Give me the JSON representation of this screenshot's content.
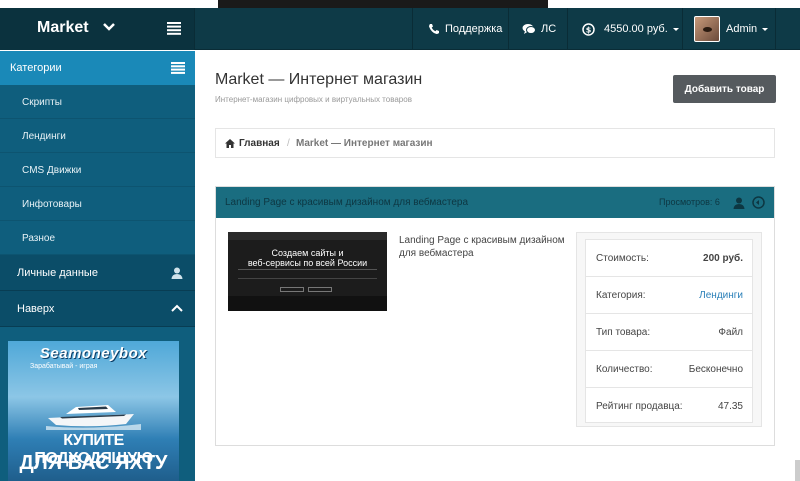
{
  "navbar": {
    "brand": "Market",
    "support_label": "Поддержка",
    "messages_label": "ЛС",
    "balance_label": "4550.00 руб.",
    "user_label": "Admin"
  },
  "sidebar": {
    "categories_header": "Категории",
    "items": [
      {
        "label": "Скрипты"
      },
      {
        "label": "Лендинги"
      },
      {
        "label": "CMS Движки"
      },
      {
        "label": "Инфотовары"
      },
      {
        "label": "Разное"
      }
    ],
    "personal_label": "Личные данные",
    "top_label": "Наверх",
    "banner": {
      "title": "Seamoneybox",
      "subtitle": "Зарабатывай - играя",
      "line1": "КУПИТЕ ПОДХОДЯЩУЮ",
      "line2": "ДЛЯ ВАС ЯХТУ"
    }
  },
  "main": {
    "title": "Market — Интернет магазин",
    "subtitle": "Интернет-магазин цифровых и виртуальных товаров",
    "add_button": "Добавить товар",
    "breadcrumb": {
      "home": "Главная",
      "separator": "/",
      "current": "Market — Интернет магазин"
    },
    "product": {
      "header_title": "Landing Page с красивым дизайном для вебмастера",
      "header_right": "Просмотров: 6",
      "thumb_heading_1": "Создаем сайты и",
      "thumb_heading_2": "веб-сервисы по всей России",
      "description": "Landing Page с красивым дизайном для вебмастера",
      "info": [
        {
          "key": "Стоимость:",
          "value": "200 руб."
        },
        {
          "key": "Категория:",
          "value": "Лендинги"
        },
        {
          "key": "Тип товара:",
          "value": "Файл"
        },
        {
          "key": "Количество:",
          "value": "Бесконечно"
        },
        {
          "key": "Рейтинг продавца:",
          "value": "47.35"
        }
      ]
    }
  },
  "colors": {
    "navbar_bg": "#0e3a47",
    "sidebar_bg": "#0f5e7d",
    "sidebar_active": "#1a89b8",
    "panel_header": "#1a6d80",
    "button_bg": "#555a5e",
    "link": "#2a7fb8"
  }
}
